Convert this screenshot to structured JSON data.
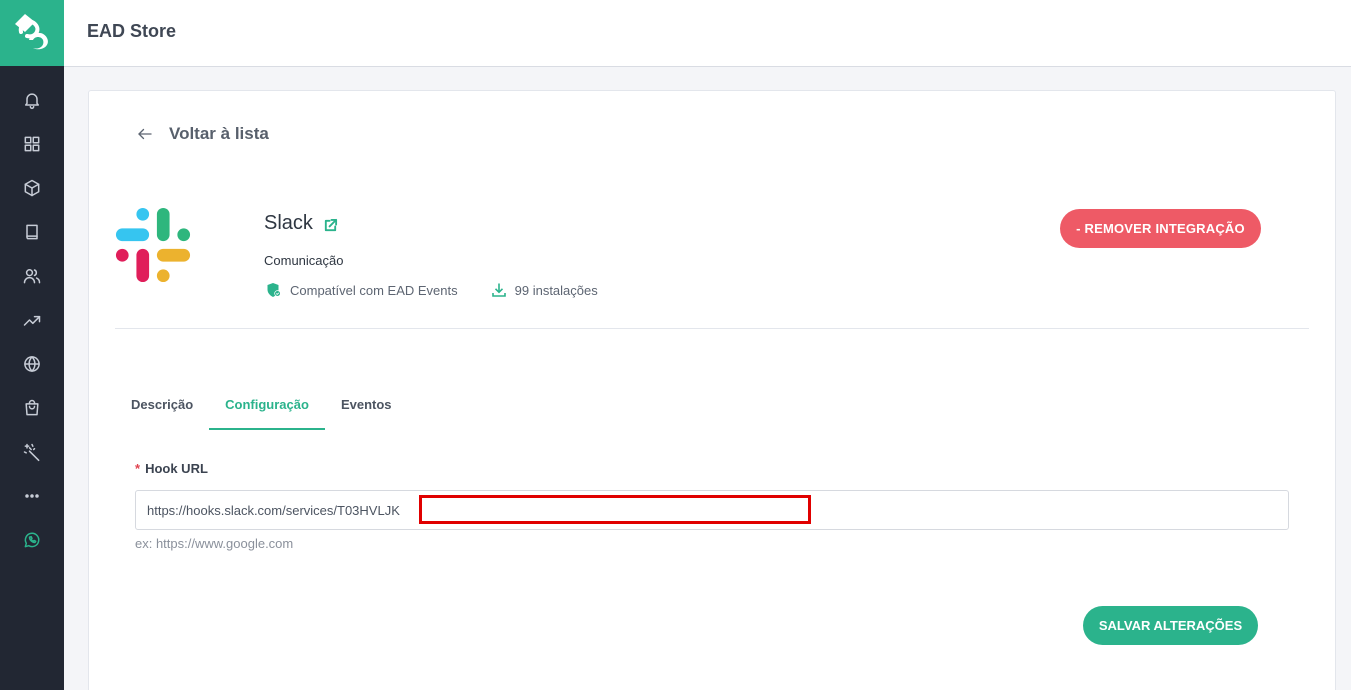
{
  "app": {
    "title": "EAD Store"
  },
  "sidebar": {
    "items": [
      {
        "icon": "bell-icon"
      },
      {
        "icon": "grid-icon"
      },
      {
        "icon": "cube-icon"
      },
      {
        "icon": "book-icon"
      },
      {
        "icon": "users-icon"
      },
      {
        "icon": "trending-icon"
      },
      {
        "icon": "globe-icon"
      },
      {
        "icon": "bag-icon"
      },
      {
        "icon": "magic-wand-icon"
      },
      {
        "icon": "more-icon"
      },
      {
        "icon": "whatsapp-icon"
      }
    ]
  },
  "back": {
    "label": "Voltar à lista"
  },
  "integration": {
    "name": "Slack",
    "category": "Comunicação",
    "compat": "Compatível com EAD Events",
    "installs": "99 instalações",
    "remove_label": "- REMOVER INTEGRAÇÃO"
  },
  "tabs": [
    {
      "label": "Descrição",
      "active": false
    },
    {
      "label": "Configuração",
      "active": true
    },
    {
      "label": "Eventos",
      "active": false
    }
  ],
  "form": {
    "required_mark": "*",
    "hook_label": "Hook URL",
    "hook_value": "https://hooks.slack.com/services/T03HVLJK",
    "hint": "ex: https://www.google.com",
    "save_label": "SALVAR ALTERAÇÕES"
  },
  "colors": {
    "accent": "#2bb38c",
    "danger": "#ee5a66",
    "sidebar_bg": "#222733",
    "redaction_box": "#e00000"
  }
}
